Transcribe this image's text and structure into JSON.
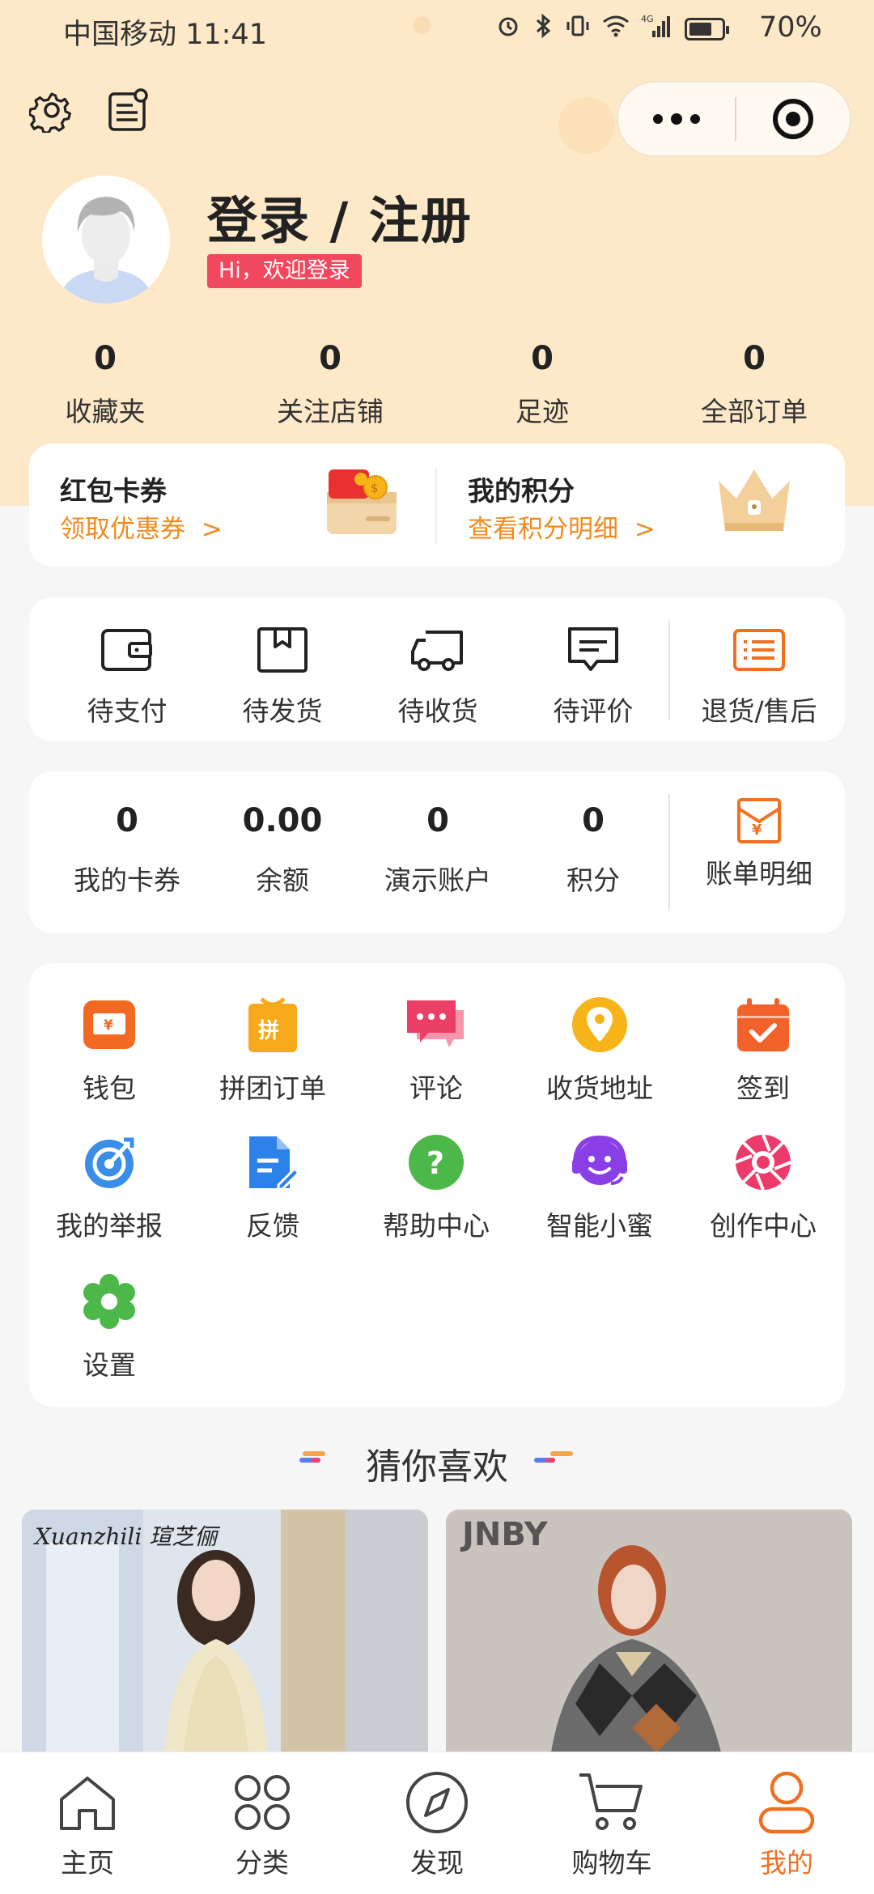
{
  "status_bar": {
    "carrier_time": "中国移动 11:41",
    "battery": "70%",
    "battery_level": 0.7,
    "network": "4G"
  },
  "profile": {
    "login_label": "登录 / 注册",
    "greeting": "Hi，欢迎登录"
  },
  "stats": [
    {
      "value": "0",
      "label": "收藏夹"
    },
    {
      "value": "0",
      "label": "关注店铺"
    },
    {
      "value": "0",
      "label": "足迹"
    },
    {
      "value": "0",
      "label": "全部订单"
    }
  ],
  "rewards": {
    "coupon_title": "红包卡券",
    "coupon_link": "领取优惠券",
    "points_title": "我的积分",
    "points_link": "查看积分明细"
  },
  "orders": [
    {
      "label": "待支付",
      "icon": "wallet-icon"
    },
    {
      "label": "待发货",
      "icon": "package-icon"
    },
    {
      "label": "待收货",
      "icon": "truck-icon"
    },
    {
      "label": "待评价",
      "icon": "review-icon"
    },
    {
      "label": "退货/售后",
      "icon": "after-sales-icon"
    }
  ],
  "wallet": [
    {
      "value": "0",
      "label": "我的卡券"
    },
    {
      "value": "0.00",
      "label": "余额"
    },
    {
      "value": "0",
      "label": "演示账户"
    },
    {
      "value": "0",
      "label": "积分"
    }
  ],
  "bill": {
    "label": "账单明细",
    "icon": "bill-icon"
  },
  "services": [
    {
      "label": "钱包",
      "icon": "wallet-icon",
      "color": "#f26a22"
    },
    {
      "label": "拼团订单",
      "icon": "group-buy-icon",
      "color": "#f6a91b"
    },
    {
      "label": "评论",
      "icon": "comment-icon",
      "color": "#ec3f66"
    },
    {
      "label": "收货地址",
      "icon": "location-icon",
      "color": "#f6b419"
    },
    {
      "label": "签到",
      "icon": "calendar-check-icon",
      "color": "#f2622a"
    },
    {
      "label": "我的举报",
      "icon": "report-icon",
      "color": "#3a8ee6"
    },
    {
      "label": "反馈",
      "icon": "feedback-icon",
      "color": "#2c82e8"
    },
    {
      "label": "帮助中心",
      "icon": "help-icon",
      "color": "#4cb84a"
    },
    {
      "label": "智能小蜜",
      "icon": "assistant-icon",
      "color": "#8a3fe6"
    },
    {
      "label": "创作中心",
      "icon": "camera-aperture-icon",
      "color": "#ec3a6a"
    },
    {
      "label": "设置",
      "icon": "settings-gear-icon",
      "color": "#4cb84a"
    }
  ],
  "guess_title": "猜你喜欢",
  "products": [
    {
      "brand": "Xuanzhili 瑄芝俪"
    },
    {
      "brand": "JNBY"
    }
  ],
  "tabs": [
    {
      "label": "主页",
      "icon": "home-icon"
    },
    {
      "label": "分类",
      "icon": "category-icon"
    },
    {
      "label": "发现",
      "icon": "compass-icon"
    },
    {
      "label": "购物车",
      "icon": "cart-icon"
    },
    {
      "label": "我的",
      "icon": "user-icon"
    }
  ],
  "colors": {
    "accent": "#f07020",
    "header_bg": "#fde9c8",
    "badge": "#f2485e",
    "link": "#f08a1e"
  }
}
